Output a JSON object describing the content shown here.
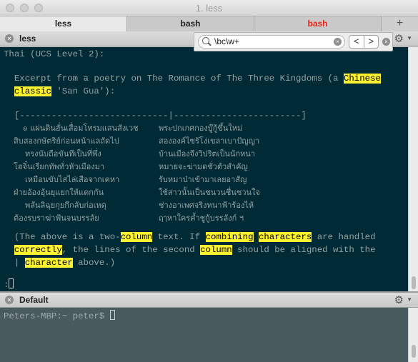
{
  "window": {
    "title": "1. less"
  },
  "tabs": [
    {
      "label": "less"
    },
    {
      "label": "bash"
    },
    {
      "label": "bash"
    }
  ],
  "new_tab_label": "+",
  "pane1": {
    "title": "less"
  },
  "pane2": {
    "title": "Default"
  },
  "search": {
    "query": "\\bc\\w+",
    "prev": "<",
    "next": ">",
    "clear": "×",
    "close": "×"
  },
  "content": {
    "line1": "Thai (UCS Level 2):",
    "l2a": "  Excerpt from a poetry on The Romance of The Three Kingdoms (a ",
    "l2b": "Chinese",
    "l3a": "classic",
    "l3b": " 'San Gua'):",
    "rule": "  [----------------------------|------------------------]",
    "thai": [
      [
        "๏ แผ่นดินฮั่นเสื่อมโทรมแสนสังเวช",
        "พระปกเกศกองบู๊กู้ขึ้นใหม่"
      ],
      [
        "สิบสองกษัตริย์ก่อนหน้าแลถัดไป",
        "สององค์ไซร้โง่เขลาเบาปัญญา"
      ],
      [
        "ทรงนับถือขันทีเป็นที่พึ่ง",
        "บ้านเมืองจึงวิปริตเป็นนักหนา"
      ],
      [
        "โฮจิ๋นเรียกทัพทั่วหัวเมืองมา",
        "หมายจะฆ่ามดชั่วตัวสำคัญ"
      ],
      [
        "เหมือนขับไสไล่เสือจากเคหา",
        "รับหมาป่าเข้ามาเลยอาสัญ"
      ],
      [
        "ฝ่ายอ้องอุ้นยุแยกให้แตกกัน",
        "ใช้สาวนั้นเป็นชนวนชื่นชวนใจ"
      ],
      [
        "พลันลิฉุยกุยกีกลับก่อเหตุ",
        "ช่างอาเพศจริงหนาฟ้าร้องไห้"
      ],
      [
        "ต้องรบราฆ่าฟันจนบรรลัย",
        "ฤๅหาใครค้ำชูกู้บรรลังก์ ฯ"
      ]
    ],
    "p1a": "  (The above is a two-",
    "p1b": "column",
    "p1c": " text. If ",
    "p1d": "combining",
    "p1e": "characters",
    "p1f": " are handled",
    "p2a": "correctly",
    "p2b": ", the lines of the second ",
    "p2c": "column",
    "p2d": " should be aligned with the",
    "p3a": "| ",
    "p3b": "character",
    "p3c": " above.)",
    "prompt_line": ":"
  },
  "shell": {
    "prompt": "Peters-MBP:~ peter$ "
  },
  "colors": {
    "terminal_bg": "#002b36",
    "text": "#93a1a1",
    "highlight": "#fdf22f",
    "tab_alert": "#e2271c"
  }
}
